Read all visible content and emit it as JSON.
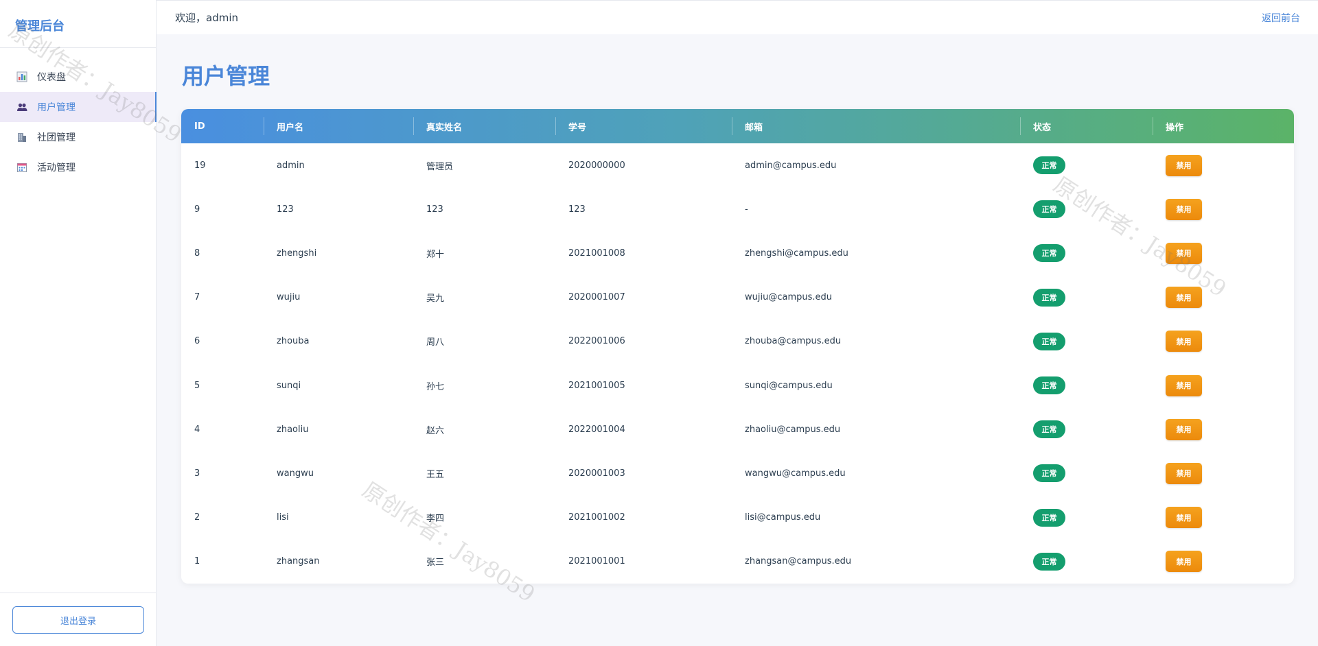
{
  "sidebar": {
    "brand": "管理后台",
    "items": [
      {
        "label": "仪表盘",
        "icon": "bar-chart-icon",
        "active": false
      },
      {
        "label": "用户管理",
        "icon": "users-icon",
        "active": true
      },
      {
        "label": "社团管理",
        "icon": "building-icon",
        "active": false
      },
      {
        "label": "活动管理",
        "icon": "calendar-icon",
        "active": false
      }
    ],
    "logout_label": "退出登录"
  },
  "topbar": {
    "welcome": "欢迎，admin",
    "back_label": "返回前台"
  },
  "page": {
    "title": "用户管理"
  },
  "table": {
    "headers": [
      "ID",
      "用户名",
      "真实姓名",
      "学号",
      "邮箱",
      "状态",
      "操作"
    ],
    "rows": [
      {
        "id": "19",
        "username": "admin",
        "realname": "管理员",
        "student_no": "2020000000",
        "email": "admin@campus.edu",
        "status": "正常",
        "action": "禁用"
      },
      {
        "id": "9",
        "username": "123",
        "realname": "123",
        "student_no": "123",
        "email": "-",
        "status": "正常",
        "action": "禁用"
      },
      {
        "id": "8",
        "username": "zhengshi",
        "realname": "郑十",
        "student_no": "2021001008",
        "email": "zhengshi@campus.edu",
        "status": "正常",
        "action": "禁用"
      },
      {
        "id": "7",
        "username": "wujiu",
        "realname": "吴九",
        "student_no": "2020001007",
        "email": "wujiu@campus.edu",
        "status": "正常",
        "action": "禁用"
      },
      {
        "id": "6",
        "username": "zhouba",
        "realname": "周八",
        "student_no": "2022001006",
        "email": "zhouba@campus.edu",
        "status": "正常",
        "action": "禁用"
      },
      {
        "id": "5",
        "username": "sunqi",
        "realname": "孙七",
        "student_no": "2021001005",
        "email": "sunqi@campus.edu",
        "status": "正常",
        "action": "禁用"
      },
      {
        "id": "4",
        "username": "zhaoliu",
        "realname": "赵六",
        "student_no": "2022001004",
        "email": "zhaoliu@campus.edu",
        "status": "正常",
        "action": "禁用"
      },
      {
        "id": "3",
        "username": "wangwu",
        "realname": "王五",
        "student_no": "2020001003",
        "email": "wangwu@campus.edu",
        "status": "正常",
        "action": "禁用"
      },
      {
        "id": "2",
        "username": "lisi",
        "realname": "李四",
        "student_no": "2021001002",
        "email": "lisi@campus.edu",
        "status": "正常",
        "action": "禁用"
      },
      {
        "id": "1",
        "username": "zhangsan",
        "realname": "张三",
        "student_no": "2021001001",
        "email": "zhangsan@campus.edu",
        "status": "正常",
        "action": "禁用"
      }
    ]
  },
  "watermark": "原创作者：Jay8059",
  "colors": {
    "accent": "#4a86d8",
    "status_ok": "#149e6e",
    "disable_button": "#f09312"
  }
}
